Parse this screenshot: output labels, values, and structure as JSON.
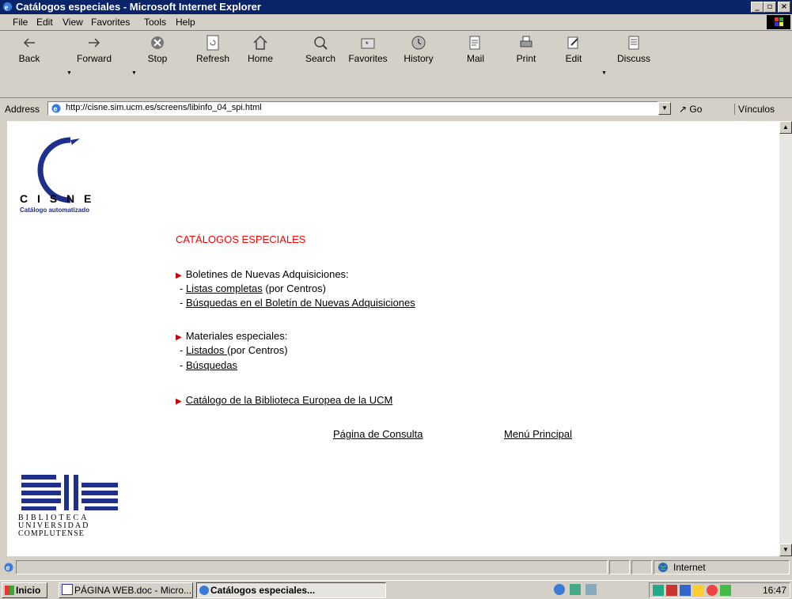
{
  "window": {
    "title": "Catálogos especiales - Microsoft Internet Explorer"
  },
  "menu": [
    {
      "label": "File"
    },
    {
      "label": "Edit"
    },
    {
      "label": "View"
    },
    {
      "label": "Favorites"
    },
    {
      "label": "Tools"
    },
    {
      "label": "Help"
    }
  ],
  "toolbar": {
    "back": "Back",
    "forward": "Forward",
    "stop": "Stop",
    "refresh": "Refresh",
    "home": "Home",
    "search": "Search",
    "favorites": "Favorites",
    "history": "History",
    "mail": "Mail",
    "print": "Print",
    "edit": "Edit",
    "discuss": "Discuss"
  },
  "address": {
    "label": "Address",
    "url": "http://cisne.sim.ucm.es/screens/libinfo_04_spi.html",
    "go": "Go",
    "links": "Vínculos"
  },
  "page": {
    "logo_top": {
      "name": "C I S N E",
      "sub": "Catálogo automatizado"
    },
    "heading": "CATÁLOGOS ESPECIALES",
    "section1": {
      "title": "Boletines de Nuevas Adquisiciones:",
      "link1": "Listas completas",
      "link1_suffix": " (por Centros)",
      "link2": "Búsquedas en el Boletín de Nuevas Adquisiciones"
    },
    "section2": {
      "title": "Materiales especiales:",
      "link1": "Listados ",
      "link1_suffix": "(por Centros)",
      "link2": "Búsquedas"
    },
    "section3": {
      "link": "Catálogo de la Biblioteca Europea de la UCM"
    },
    "footer_links": {
      "consulta": "Página de Consulta",
      "principal": "Menú Principal"
    },
    "logo_bottom": {
      "line1": "BIBLIOTECA",
      "line2": "UNIVERSIDAD",
      "line3": "COMPLUTENSE"
    }
  },
  "status": {
    "zone": "Internet"
  },
  "taskbar": {
    "start": "Inicio",
    "tasks": [
      {
        "label": "PÁGINA WEB.doc - Micro..."
      },
      {
        "label": "Catálogos especiales..."
      }
    ],
    "clock": "16:47"
  },
  "colors": {
    "titlebar": "#0a246a",
    "heading": "#ff0000",
    "logo_blue": "#1e2f8c"
  }
}
